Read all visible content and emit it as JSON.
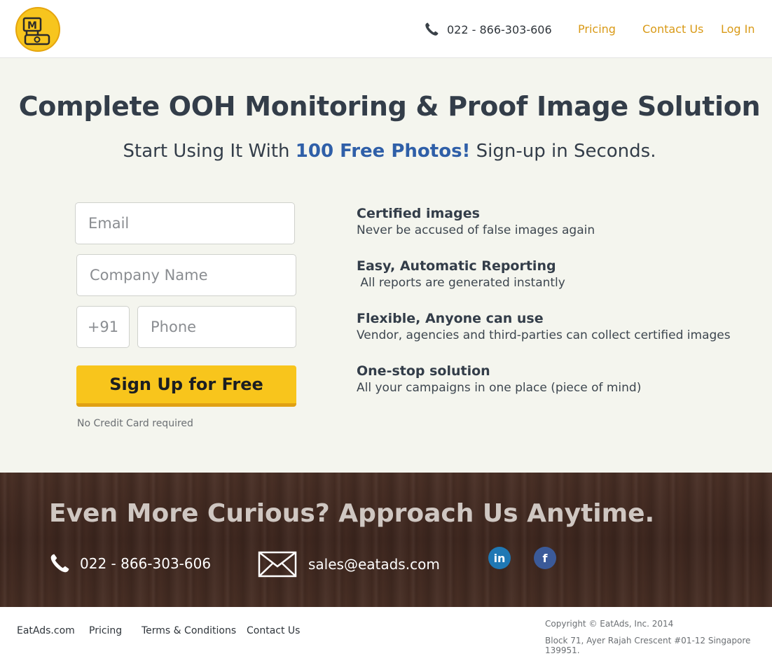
{
  "header": {
    "phone": "022 - 866-303-606",
    "nav": [
      "Pricing",
      "Contact Us",
      "Log In"
    ],
    "logo_letter": "M"
  },
  "hero": {
    "title": "Complete OOH Monitoring & Proof Image Solution",
    "subtitle_prefix": "Start Using It With ",
    "subtitle_highlight": "100 Free Photos!",
    "subtitle_suffix": " Sign-up in Seconds."
  },
  "form": {
    "email_placeholder": "Email",
    "company_placeholder": "Company Name",
    "country_code": "+91",
    "phone_placeholder": "Phone",
    "submit_label": "Sign Up for Free",
    "note": "No Credit Card required"
  },
  "features": [
    {
      "title": "Certified images",
      "desc": "Never be accused of false images again"
    },
    {
      "title": "Easy, Automatic Reporting",
      "desc": " All reports are generated instantly"
    },
    {
      "title": "Flexible, Anyone can use",
      "desc": "Vendor, agencies and third-parties can collect certified images"
    },
    {
      "title": "One-stop solution",
      "desc": "All your campaigns in one place (piece of mind)"
    }
  ],
  "contact_banner": {
    "title": "Even More Curious? Approach Us Anytime.",
    "phone": "022 - 866-303-606",
    "email": "sales@eatads.com",
    "social": [
      "in",
      "f"
    ]
  },
  "footer": {
    "links": [
      "EatAds.com",
      "Pricing",
      "Terms & Conditions",
      "Contact Us"
    ],
    "copyright": "Copyright © EatAds, Inc. 2014",
    "address": "Block 71, Ayer Rajah Crescent #01-12 Singapore 139951."
  },
  "colors": {
    "accent_yellow": "#f8c51c",
    "nav_link": "#d99a17",
    "highlight_blue": "#2f5fa8",
    "hero_bg": "#f4f5ee",
    "wood_bg": "#3e271f"
  }
}
